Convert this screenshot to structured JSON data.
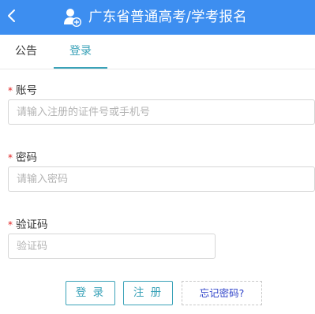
{
  "header": {
    "title": "广东省普通高考/学考报名",
    "back_icon": "chevron-left-icon",
    "logo_icon": "user-add-icon",
    "bg_color": "#3d8ef0"
  },
  "tabs": [
    {
      "label": "公告",
      "active": false
    },
    {
      "label": "登录",
      "active": true
    }
  ],
  "form": {
    "required_mark": "*",
    "account": {
      "label": "账号",
      "value": "",
      "placeholder": "请输入注册的证件号或手机号"
    },
    "password": {
      "label": "密码",
      "value": "",
      "placeholder": "请输入密码"
    },
    "captcha": {
      "label": "验证码",
      "value": "",
      "placeholder": "验证码"
    }
  },
  "actions": {
    "login_label": "登 录",
    "register_label": "注 册",
    "forgot_label": "忘记密码?"
  },
  "colors": {
    "accent": "#3aa2b8",
    "required": "#e02020",
    "link": "#2f43c9"
  }
}
